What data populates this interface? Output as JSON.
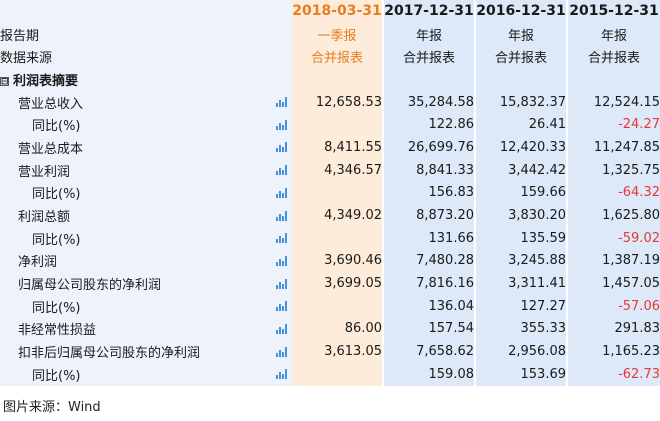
{
  "header": {
    "col_label": "",
    "periods": [
      "2018-03-31",
      "2017-12-31",
      "2016-12-31",
      "2015-12-31"
    ]
  },
  "meta_rows": [
    {
      "label": "报告期",
      "values": [
        "一季报",
        "年报",
        "年报",
        "年报"
      ]
    },
    {
      "label": "数据来源",
      "values": [
        "合并报表",
        "合并报表",
        "合并报表",
        "合并报表"
      ]
    }
  ],
  "section": {
    "toggle": "⊟",
    "title": "利润表摘要"
  },
  "rows": [
    {
      "label": "营业总收入",
      "indent": 1,
      "values": [
        "12,658.53",
        "35,284.58",
        "15,832.37",
        "12,524.15"
      ]
    },
    {
      "label": "同比(%)",
      "indent": 2,
      "values": [
        "",
        "122.86",
        "26.41",
        "-24.27"
      ]
    },
    {
      "label": "营业总成本",
      "indent": 1,
      "values": [
        "8,411.55",
        "26,699.76",
        "12,420.33",
        "11,247.85"
      ]
    },
    {
      "label": "营业利润",
      "indent": 1,
      "values": [
        "4,346.57",
        "8,841.33",
        "3,442.42",
        "1,325.75"
      ]
    },
    {
      "label": "同比(%)",
      "indent": 2,
      "values": [
        "",
        "156.83",
        "159.66",
        "-64.32"
      ]
    },
    {
      "label": "利润总额",
      "indent": 1,
      "values": [
        "4,349.02",
        "8,873.20",
        "3,830.20",
        "1,625.80"
      ]
    },
    {
      "label": "同比(%)",
      "indent": 2,
      "values": [
        "",
        "131.66",
        "135.59",
        "-59.02"
      ]
    },
    {
      "label": "净利润",
      "indent": 1,
      "values": [
        "3,690.46",
        "7,480.28",
        "3,245.88",
        "1,387.19"
      ]
    },
    {
      "label": "归属母公司股东的净利润",
      "indent": 1,
      "values": [
        "3,699.05",
        "7,816.16",
        "3,311.41",
        "1,457.05"
      ]
    },
    {
      "label": "同比(%)",
      "indent": 2,
      "values": [
        "",
        "136.04",
        "127.27",
        "-57.06"
      ]
    },
    {
      "label": "非经常性损益",
      "indent": 1,
      "values": [
        "86.00",
        "157.54",
        "355.33",
        "291.83"
      ]
    },
    {
      "label": "扣非后归属母公司股东的净利润",
      "indent": 1,
      "values": [
        "3,613.05",
        "7,658.62",
        "2,956.08",
        "1,165.23"
      ]
    },
    {
      "label": "同比(%)",
      "indent": 2,
      "values": [
        "",
        "159.08",
        "153.69",
        "-62.73"
      ]
    }
  ],
  "icons": {
    "row_chart": "bar-chart-icon"
  },
  "colors": {
    "highlight": "#e67e22",
    "negative": "#e53935",
    "label_bg": "#eef3fb",
    "col_bg": "#dde9f8",
    "col1_bg": "#fdecd9"
  },
  "caption": "图片来源：Wind"
}
